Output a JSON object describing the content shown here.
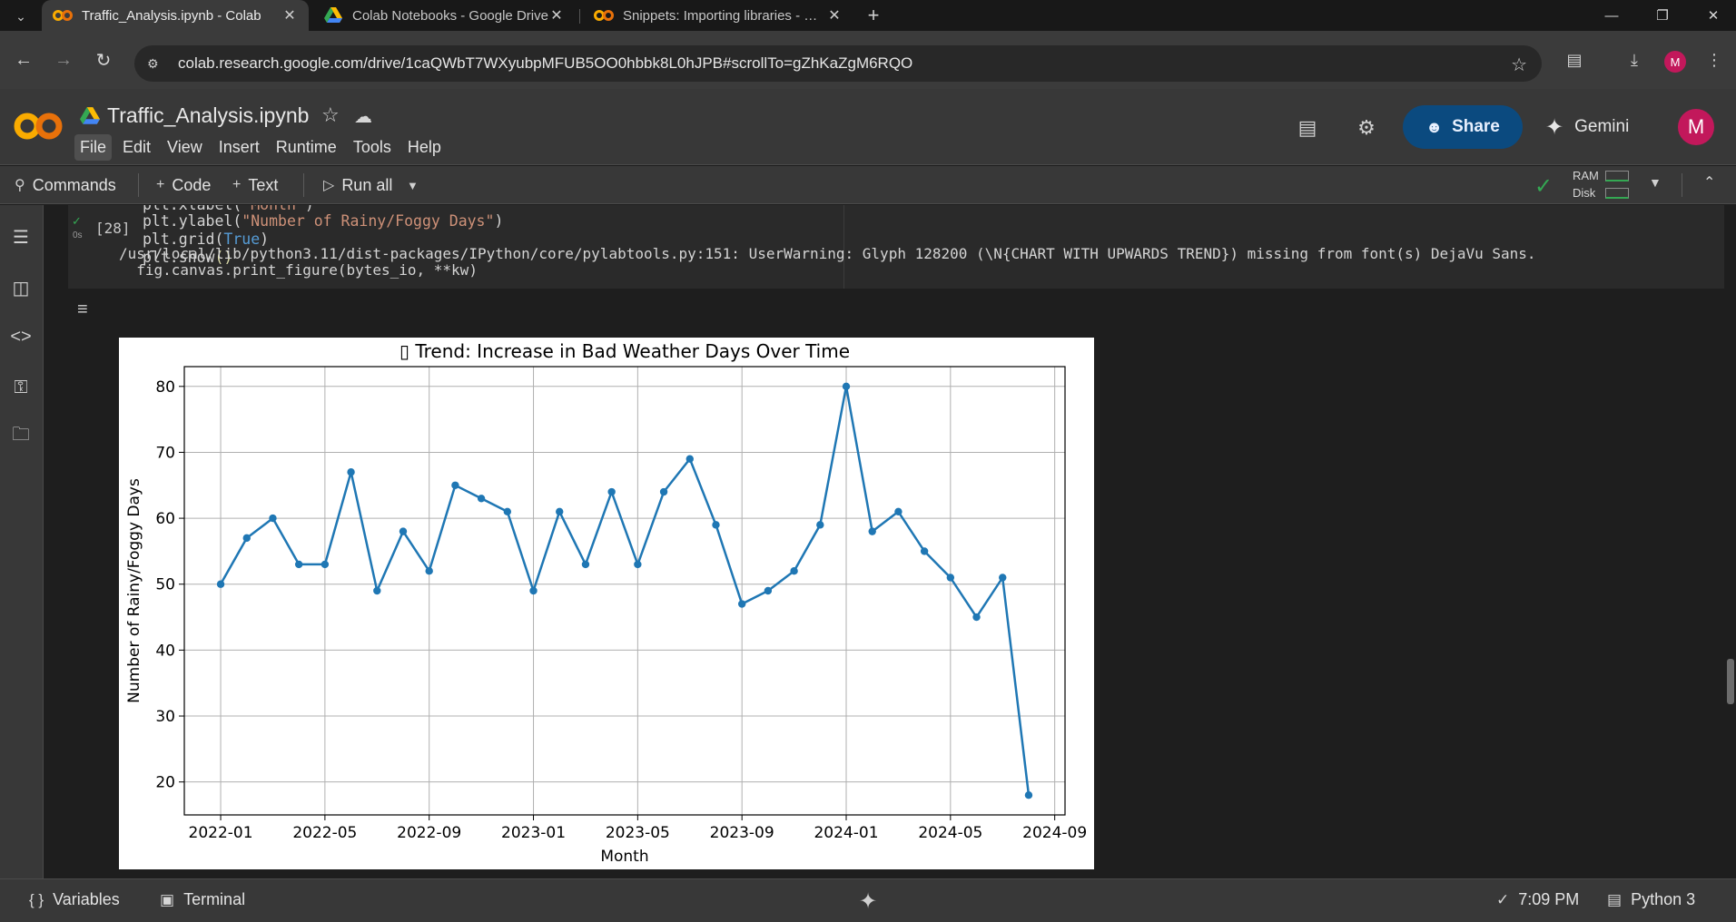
{
  "browser": {
    "tabs": [
      {
        "label": "Traffic_Analysis.ipynb - Colab",
        "icon": "colab-icon",
        "active": true
      },
      {
        "label": "Colab Notebooks - Google Drive",
        "icon": "google-drive-icon",
        "active": false
      },
      {
        "label": "Snippets: Importing libraries - Colab",
        "icon": "colab-icon",
        "active": false
      }
    ],
    "url": "colab.research.google.com/drive/1caQWbT7WXyubpMFUB5OO0hbbk8L0hJPB#scrollTo=gZhKaZgM6RQO",
    "profile_initial": "M"
  },
  "colab": {
    "notebook_title": "Traffic_Analysis.ipynb",
    "menu": [
      "File",
      "Edit",
      "View",
      "Insert",
      "Runtime",
      "Tools",
      "Help"
    ],
    "share_label": "Share",
    "gemini_label": "Gemini",
    "avatar_initial": "M",
    "toolbar": {
      "commands": "Commands",
      "code": "Code",
      "text": "Text",
      "run_all": "Run all",
      "ram": "RAM",
      "disk": "Disk"
    }
  },
  "cell": {
    "execution_count": "[28]",
    "run_time": "0s",
    "code_lines": [
      {
        "pre": "plt.xlabel(",
        "str": "\"Month\"",
        "post": ")"
      },
      {
        "pre": "plt.ylabel(",
        "str": "\"Number of Rainy/Foggy Days\"",
        "post": ")"
      },
      {
        "pre": "plt.grid(",
        "kw": "True",
        "post": ")"
      },
      {
        "pre": "plt.show",
        "post": "()"
      }
    ],
    "warning_lines": [
      "/usr/local/lib/python3.11/dist-packages/IPython/core/pylabtools.py:151: UserWarning: Glyph 128200 (\\N{CHART WITH UPWARDS TREND}) missing from font(s) DejaVu Sans.",
      "  fig.canvas.print_figure(bytes_io, **kw)"
    ]
  },
  "chart_data": {
    "type": "line",
    "title": "▯ Trend: Increase in Bad Weather Days Over Time",
    "xlabel": "Month",
    "ylabel": "Number of Rainy/Foggy Days",
    "x": [
      "2022-01",
      "2022-02",
      "2022-03",
      "2022-04",
      "2022-05",
      "2022-06",
      "2022-07",
      "2022-08",
      "2022-09",
      "2022-10",
      "2022-11",
      "2022-12",
      "2023-01",
      "2023-02",
      "2023-03",
      "2023-04",
      "2023-05",
      "2023-06",
      "2023-07",
      "2023-08",
      "2023-09",
      "2023-10",
      "2023-11",
      "2023-12",
      "2024-01",
      "2024-02",
      "2024-03",
      "2024-04",
      "2024-05",
      "2024-06",
      "2024-07",
      "2024-08"
    ],
    "values": [
      50,
      57,
      60,
      53,
      53,
      67,
      49,
      58,
      52,
      65,
      63,
      61,
      49,
      61,
      53,
      64,
      53,
      64,
      69,
      59,
      47,
      49,
      52,
      59,
      80,
      58,
      61,
      55,
      51,
      45,
      51,
      18
    ],
    "x_ticks": [
      "2022-01",
      "2022-05",
      "2022-09",
      "2023-01",
      "2023-05",
      "2023-09",
      "2024-01",
      "2024-05",
      "2024-09"
    ],
    "y_ticks": [
      20,
      30,
      40,
      50,
      60,
      70,
      80
    ],
    "ylim": [
      15,
      83
    ],
    "grid": true,
    "line_color": "#1f77b4"
  },
  "statusbar": {
    "variables": "Variables",
    "terminal": "Terminal",
    "time": "7:09 PM",
    "runtime": "Python 3"
  }
}
